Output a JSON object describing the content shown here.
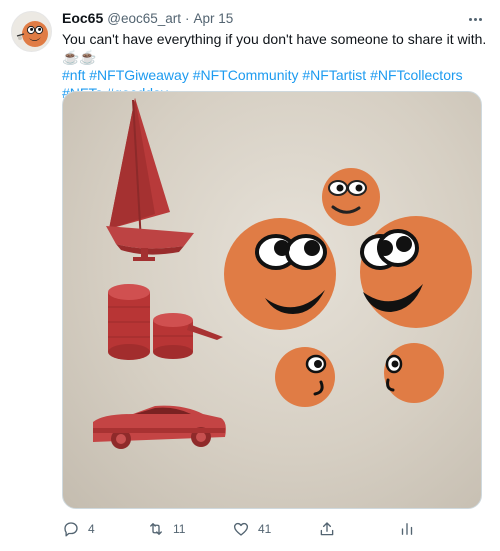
{
  "tweet": {
    "author": {
      "name": "Eoc65",
      "handle": "@eoc65_art",
      "separator": "·",
      "date": "Apr 15"
    },
    "text": "You can't have everything if you don't have someone to share it with.☕☕",
    "hashtags": "#nft #NFTGiweaway #NFTCommunity #NFTartist #NFTcollectors  #NFTs #goodday",
    "media_icons": [
      "sailboat",
      "coin-stack",
      "sports-car",
      "cartoon-face"
    ],
    "actions": {
      "reply_count": "4",
      "retweet_count": "11",
      "like_count": "41"
    }
  }
}
